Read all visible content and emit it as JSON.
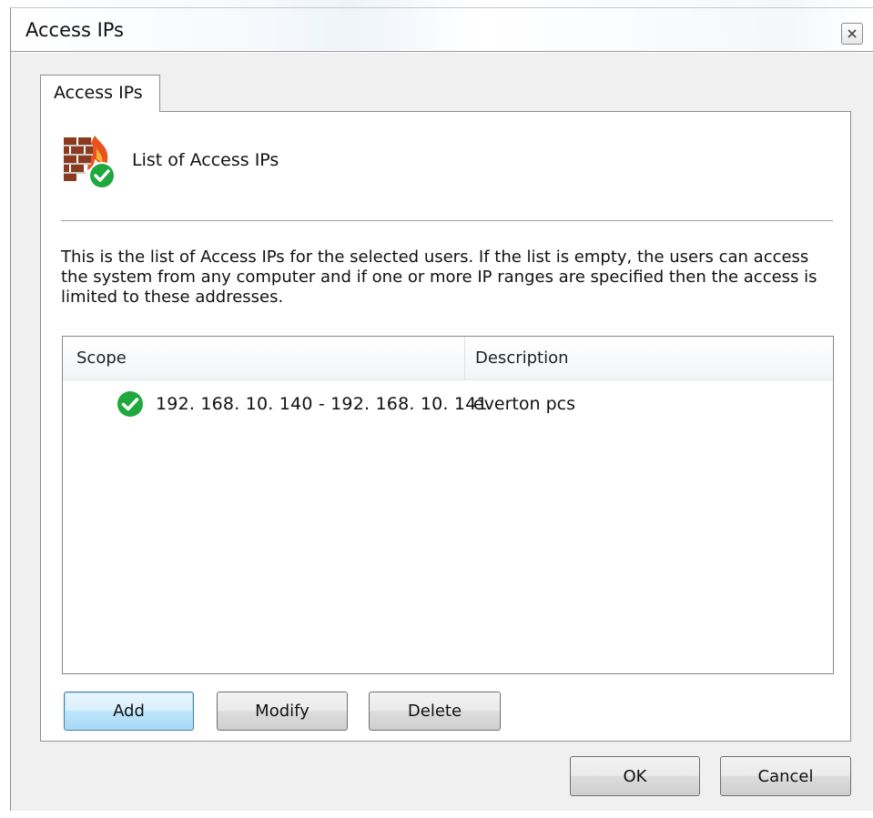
{
  "window": {
    "title": "Access IPs",
    "close_icon": "close-icon"
  },
  "tabs": [
    {
      "label": "Access IPs",
      "selected": true
    }
  ],
  "header": {
    "icon": "firewall-check-icon",
    "title": "List of Access IPs"
  },
  "description": "This is the list of Access IPs for the selected users. If the list is empty, the users can access the system from any computer and if one or more IP ranges are specified then the access is limited to these addresses.",
  "list": {
    "columns": [
      "Scope",
      "Description"
    ],
    "rows": [
      {
        "icon": "green-check-icon",
        "scope": "192. 168. 10. 140 - 192. 168. 10. 141",
        "description": "everton pcs"
      }
    ]
  },
  "panel_buttons": {
    "add": "Add",
    "modify": "Modify",
    "delete": "Delete"
  },
  "dialog_buttons": {
    "ok": "OK",
    "cancel": "Cancel"
  },
  "colors": {
    "check_green": "#1fa83c",
    "firewall_brick": "#8b3a1e",
    "firewall_flame": "#e8531f",
    "default_button_border": "#3c7fb1"
  }
}
